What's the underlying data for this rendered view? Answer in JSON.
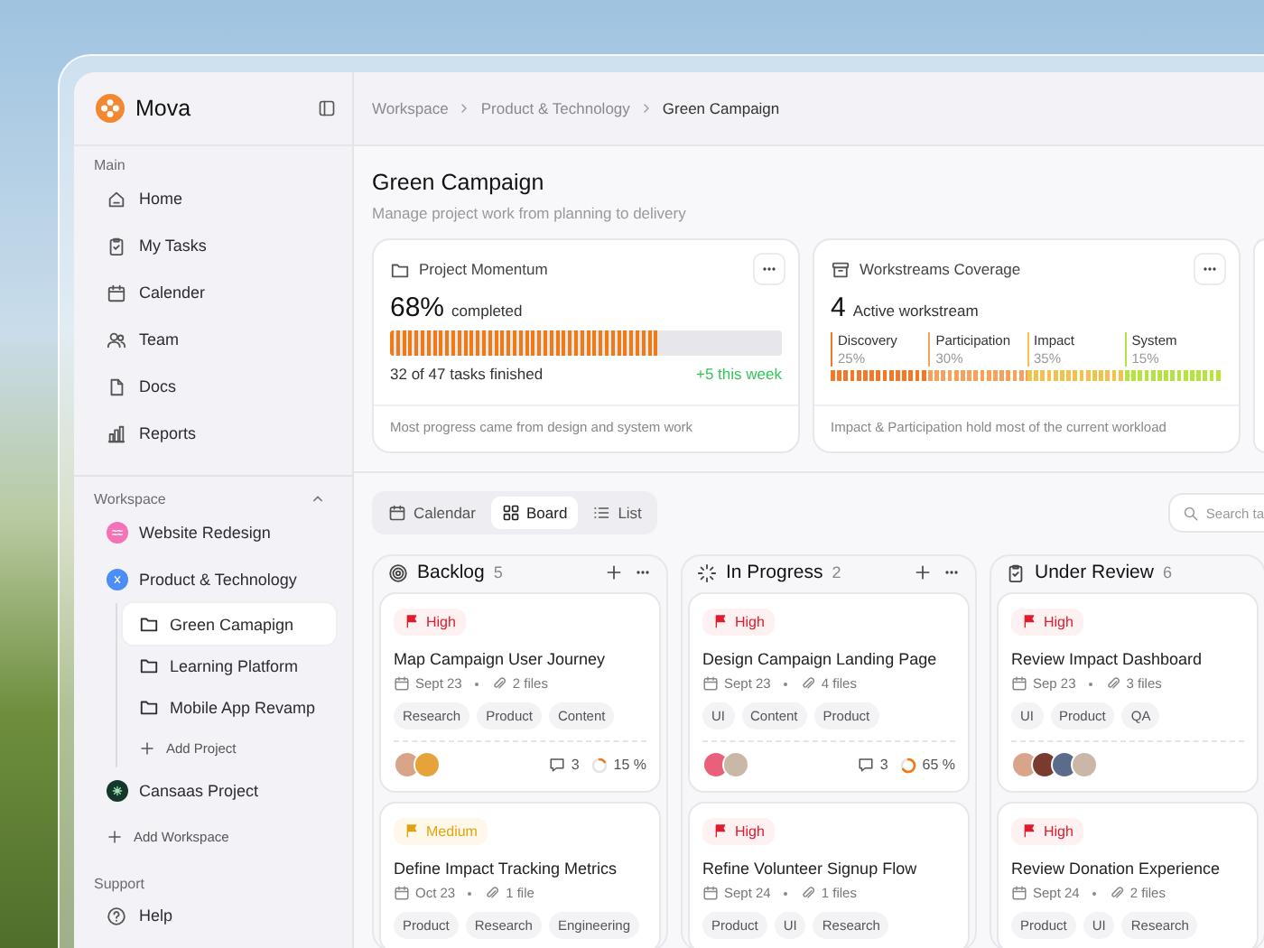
{
  "sidebar": {
    "brand": "Mova",
    "main_title": "Main",
    "main_items": [
      {
        "label": "Home"
      },
      {
        "label": "My Tasks"
      },
      {
        "label": "Calender"
      },
      {
        "label": "Team"
      },
      {
        "label": "Docs"
      },
      {
        "label": "Reports"
      }
    ],
    "workspace_title": "Workspace",
    "workspace_expanded": true,
    "workspaces": [
      {
        "label": "Website Redesign",
        "color": "#f472b6"
      },
      {
        "label": "Product & Technology",
        "color": "#4c8df6",
        "children": [
          {
            "label": "Green Camapign",
            "selected": true
          },
          {
            "label": "Learning Platform",
            "selected": false
          },
          {
            "label": "Mobile App Revamp",
            "selected": false
          }
        ],
        "add_label": "Add Project"
      },
      {
        "label": "Cansaas Project",
        "color": "#12392c"
      }
    ],
    "add_workspace": "Add Workspace",
    "support_title": "Support",
    "support_items": [
      {
        "label": "Help"
      }
    ]
  },
  "breadcrumb": [
    "Workspace",
    "Product & Technology",
    "Green Campaign"
  ],
  "header": {
    "title": "Green Campaign",
    "subtitle": "Manage project work from planning to delivery"
  },
  "stats": [
    {
      "kind": "progress",
      "title": "Project Momentum",
      "value": "68%",
      "value_label": "completed",
      "level": 0.68,
      "detail": "32 of 47 tasks finished",
      "delta": "+5 this week",
      "footer": "Most progress came from design and system work"
    },
    {
      "kind": "coverage",
      "title": "Workstreams Coverage",
      "value": "4",
      "value_label": "Active workstream",
      "streams": [
        {
          "name": "Discovery",
          "share": "25%",
          "color": "#f07a2a"
        },
        {
          "name": "Participation",
          "share": "30%",
          "color": "#f5a25a"
        },
        {
          "name": "Impact",
          "share": "35%",
          "color": "#f2c24e"
        },
        {
          "name": "System",
          "share": "15%",
          "color": "#b5e33f"
        }
      ],
      "footer": "Impact & Participation hold most of the current workload"
    }
  ],
  "views": [
    {
      "label": "Calendar",
      "selected": false
    },
    {
      "label": "Board",
      "selected": true
    },
    {
      "label": "List",
      "selected": false
    }
  ],
  "search": {
    "placeholder": "Search ta"
  },
  "columns": [
    {
      "title": "Backlog",
      "count": "5",
      "controls": true,
      "cards": [
        {
          "priority": {
            "kind": "high",
            "label": "High"
          },
          "title": "Map Campaign User Journey",
          "date": "Sept 23",
          "files": "2 files",
          "tags": [
            "Research",
            "Product",
            "Content"
          ],
          "avatars": [
            {
              "color": "#d9a58a"
            },
            {
              "color": "#e5a33a"
            }
          ],
          "comments": "3",
          "progress": "15 %"
        },
        {
          "priority": {
            "kind": "medium",
            "label": "Medium"
          },
          "title": "Define Impact Tracking Metrics",
          "date": "Oct 23",
          "files": "1 file",
          "tags": [
            "Product",
            "Research",
            "Engineering"
          ]
        }
      ]
    },
    {
      "title": "In Progress",
      "count": "2",
      "controls": true,
      "cards": [
        {
          "priority": {
            "kind": "high",
            "label": "High"
          },
          "title": "Design Campaign Landing Page",
          "date": "Sept 23",
          "files": "4 files",
          "tags": [
            "UI",
            "Content",
            "Product"
          ],
          "avatars": [
            {
              "color": "#e8607a"
            },
            {
              "color": "#c9b8a6"
            }
          ],
          "comments": "3",
          "progress": "65 %"
        },
        {
          "priority": {
            "kind": "high",
            "label": "High"
          },
          "title": "Refine Volunteer Signup Flow",
          "date": "Sept 24",
          "files": "1 files",
          "tags": [
            "Product",
            "UI",
            "Research"
          ]
        }
      ]
    },
    {
      "title": "Under Review",
      "count": "6",
      "controls": false,
      "cards": [
        {
          "priority": {
            "kind": "high",
            "label": "High"
          },
          "title": "Review Impact Dashboard",
          "date": "Sep 23",
          "files": "3 files",
          "tags": [
            "UI",
            "Product",
            "QA"
          ],
          "avatars": [
            {
              "color": "#d9a58a"
            },
            {
              "color": "#7a3b2e"
            },
            {
              "color": "#5b6b8a"
            },
            {
              "color": "#cbb7a8"
            }
          ]
        },
        {
          "priority": {
            "kind": "high",
            "label": "High"
          },
          "title": "Review Donation Experience",
          "date": "Sept 24",
          "files": "2 files",
          "tags": [
            "Product",
            "UI",
            "Research"
          ]
        }
      ]
    }
  ]
}
